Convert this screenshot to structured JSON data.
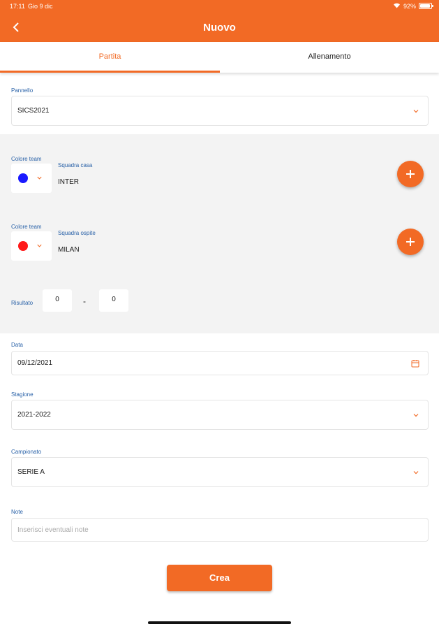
{
  "status_bar": {
    "time": "17:11",
    "date": "Gio 9 dic",
    "battery": "92%",
    "battery_level": 0.92
  },
  "header": {
    "title": "Nuovo"
  },
  "tabs": [
    {
      "label": "Partita",
      "active": true
    },
    {
      "label": "Allenamento",
      "active": false
    }
  ],
  "form": {
    "panel": {
      "label": "Pannello",
      "value": "SICS2021"
    },
    "home": {
      "color_label": "Colore team",
      "team_label": "Squadra casa",
      "team": "INTER",
      "color": "#1a1aff"
    },
    "away": {
      "color_label": "Colore team",
      "team_label": "Squadra ospite",
      "team": "MILAN",
      "color": "#ff1a1a"
    },
    "result": {
      "label": "Risultato",
      "home_score": "0",
      "separator": "-",
      "away_score": "0"
    },
    "date": {
      "label": "Data",
      "value": "09/12/2021"
    },
    "season": {
      "label": "Stagione",
      "value": "2021-2022"
    },
    "championship": {
      "label": "Campionato",
      "value": "SERIE A"
    },
    "notes": {
      "label": "Note",
      "placeholder": "Inserisci eventuali note"
    }
  },
  "actions": {
    "create_label": "Crea"
  },
  "colors": {
    "accent": "#f26a25",
    "label_blue": "#2a62a8",
    "panel_grey": "#f3f3f3"
  }
}
